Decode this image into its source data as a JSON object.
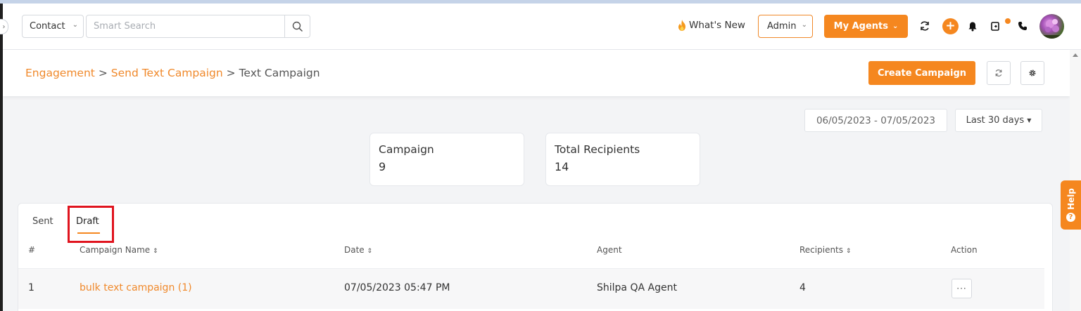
{
  "header": {
    "contact_select": "Contact",
    "search_placeholder": "Smart Search",
    "whats_new": "What's New",
    "admin_select": "Admin",
    "agents_button": "My Agents",
    "icons": [
      "search-icon",
      "fire-icon",
      "refresh-icon",
      "plus-icon",
      "bell-icon",
      "status-icon",
      "phone-icon",
      "avatar"
    ]
  },
  "breadcrumb": {
    "items": [
      "Engagement",
      "Send Text Campaign",
      "Text Campaign"
    ],
    "separator": ">"
  },
  "toolbar": {
    "create_label": "Create Campaign"
  },
  "filters": {
    "date_range": "06/05/2023 - 07/05/2023",
    "range_label": "Last 30 days"
  },
  "stats": [
    {
      "label": "Campaign",
      "value": "9"
    },
    {
      "label": "Total Recipients",
      "value": "14"
    }
  ],
  "tabs": [
    {
      "label": "Sent",
      "active": false
    },
    {
      "label": "Draft",
      "active": true
    }
  ],
  "table": {
    "headers": [
      "#",
      "Campaign Name",
      "Date",
      "Agent",
      "Recipients",
      "Action"
    ],
    "sortable": [
      false,
      true,
      true,
      false,
      true,
      false
    ],
    "rows": [
      {
        "index": "1",
        "name": "bulk text campaign (1)",
        "date": "07/05/2023 05:47 PM",
        "agent": "Shilpa QA Agent",
        "recipients": "4",
        "action": "···"
      }
    ]
  },
  "help_label": "Help",
  "colors": {
    "accent": "#f5871f",
    "highlight": "#e0141e"
  }
}
